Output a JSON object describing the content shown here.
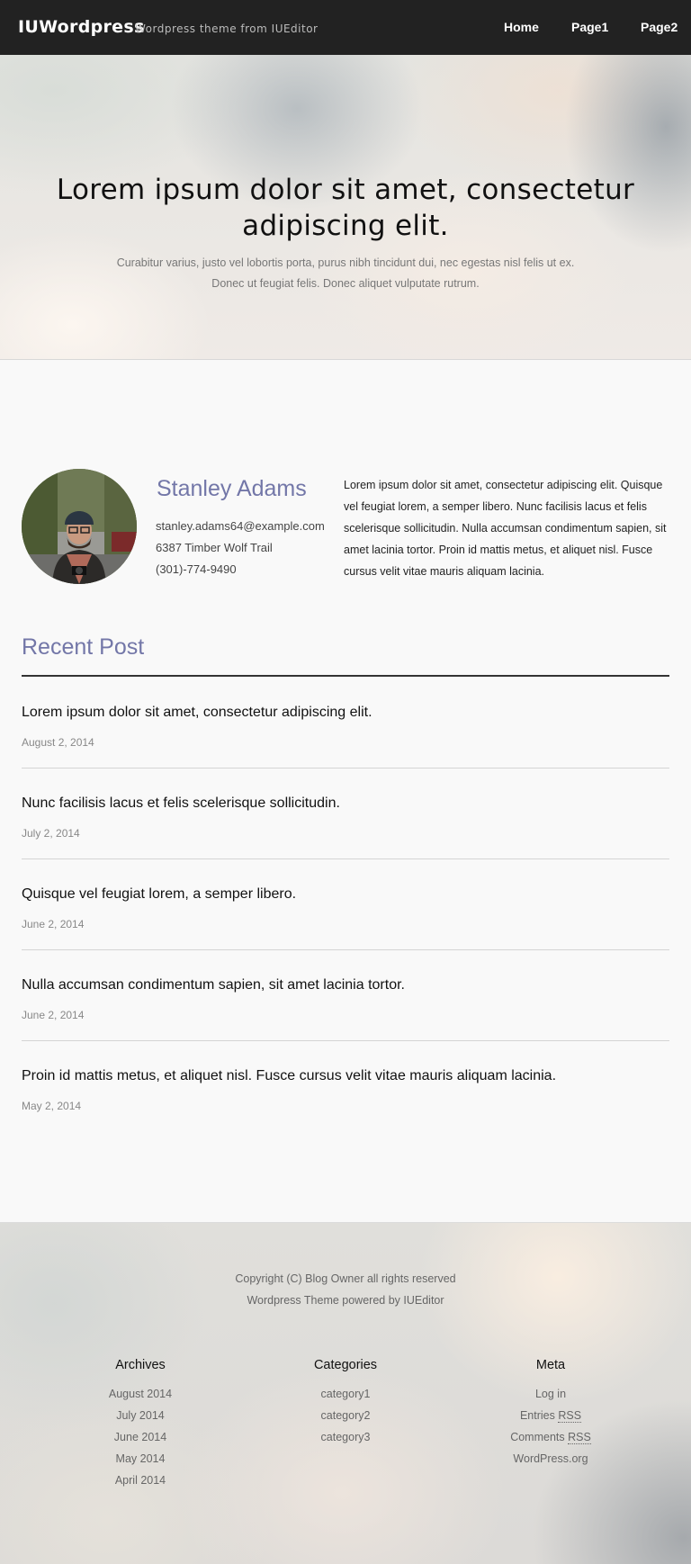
{
  "header": {
    "brand": "IUWordpress",
    "tagline": "Wordpress theme from IUEditor",
    "nav": [
      "Home",
      "Page1",
      "Page2"
    ]
  },
  "hero": {
    "title": "Lorem ipsum dolor sit amet, consectetur adipiscing elit.",
    "subtitle_line1": "Curabitur varius, justo vel lobortis porta, purus nibh tincidunt dui, nec egestas nisl felis ut ex.",
    "subtitle_line2": "Donec ut feugiat felis. Donec aliquet vulputate rutrum."
  },
  "profile": {
    "name": "Stanley Adams",
    "email": "stanley.adams64@example.com",
    "address": "6387 Timber Wolf Trail",
    "phone": "(301)-774-9490",
    "bio": "Lorem ipsum dolor sit amet, consectetur adipiscing elit. Quisque vel feugiat lorem, a semper libero. Nunc facilisis lacus et felis scelerisque sollicitudin. Nulla accumsan condimentum sapien, sit amet lacinia tortor. Proin id mattis metus, et aliquet nisl. Fusce cursus velit vitae mauris aliquam lacinia."
  },
  "recent": {
    "title": "Recent Post",
    "posts": [
      {
        "title": "Lorem ipsum dolor sit amet, consectetur adipiscing elit.",
        "date": "August 2, 2014"
      },
      {
        "title": "Nunc facilisis lacus et felis scelerisque sollicitudin.",
        "date": "July 2, 2014"
      },
      {
        "title": "Quisque vel feugiat lorem, a semper libero.",
        "date": "June 2, 2014"
      },
      {
        "title": "Nulla accumsan condimentum sapien, sit amet lacinia tortor.",
        "date": "June 2, 2014"
      },
      {
        "title": "Proin id mattis metus, et aliquet nisl. Fusce cursus velit vitae mauris aliquam lacinia.",
        "date": "May 2, 2014"
      }
    ]
  },
  "footer": {
    "copyright": "Copyright (C) Blog Owner all rights reserved",
    "powered": "Wordpress Theme powered by IUEditor",
    "archives": {
      "title": "Archives",
      "items": [
        "August 2014",
        "July 2014",
        "June 2014",
        "May 2014",
        "April 2014"
      ]
    },
    "categories": {
      "title": "Categories",
      "items": [
        "category1",
        "category2",
        "category3"
      ]
    },
    "meta": {
      "title": "Meta",
      "login": "Log in",
      "entries_prefix": "Entries",
      "comments_prefix": "Comments",
      "rss": "RSS",
      "wordpress_org": "WordPress.org"
    }
  }
}
